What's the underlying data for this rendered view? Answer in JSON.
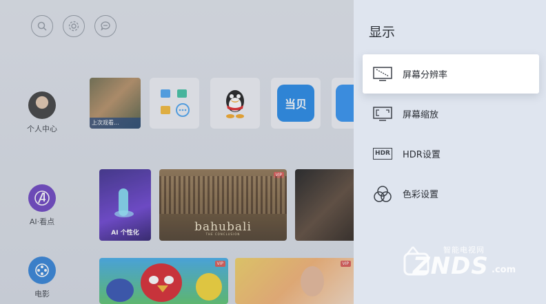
{
  "top_icons": [
    "search-icon",
    "gear-icon",
    "message-icon"
  ],
  "sidebar": {
    "items": [
      {
        "label": "个人中心",
        "icon": "avatar"
      },
      {
        "label": "AI·看点",
        "icon": "avengers-icon"
      },
      {
        "label": "电影",
        "icon": "film-reel-icon"
      }
    ]
  },
  "row1": {
    "recent_label": "上次观看...",
    "apps": [
      {
        "label": "",
        "icon": "app-grid-icon"
      },
      {
        "label": "",
        "icon": "qq-icon"
      },
      {
        "label": "当贝",
        "icon": "dangbei-icon"
      },
      {
        "label": "",
        "icon": "browser-icon"
      }
    ]
  },
  "row2": {
    "ai_label": "AI 个性化",
    "movie_title": "bahubali",
    "movie_subtitle": "THE CONCLUSION",
    "vip": "VIP"
  },
  "row3": {
    "vip1": "VIP",
    "vip2": "VIP"
  },
  "panel": {
    "title": "显示",
    "items": [
      {
        "label": "屏幕分辨率",
        "icon": "resolution-icon",
        "selected": true
      },
      {
        "label": "屏幕缩放",
        "icon": "screen-scale-icon",
        "selected": false
      },
      {
        "label": "HDR设置",
        "icon": "hdr-icon",
        "badge": "HDR",
        "selected": false
      },
      {
        "label": "色彩设置",
        "icon": "color-circles-icon",
        "selected": false
      }
    ]
  },
  "watermark": {
    "top": "智能电视网",
    "main": "ZNDS",
    "suffix": ".com"
  },
  "colors": {
    "panel_bg": "#dfe5ef",
    "selected_bg": "#ffffff",
    "text": "#2b2f36"
  }
}
